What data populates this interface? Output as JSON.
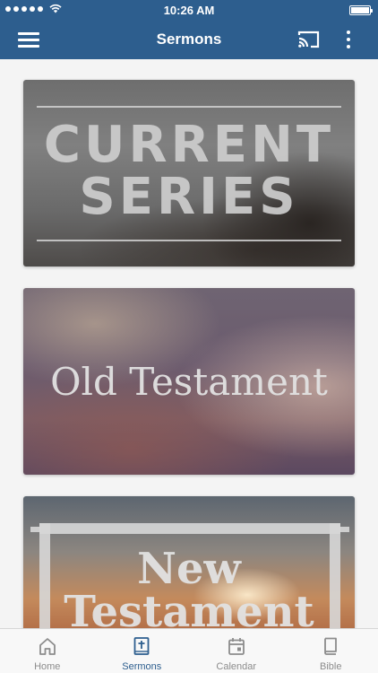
{
  "status_bar": {
    "time": "10:26 AM"
  },
  "nav": {
    "title": "Sermons"
  },
  "cards": [
    {
      "lines": [
        "CURRENT",
        "SERIES"
      ]
    },
    {
      "lines": [
        "Old Testament"
      ]
    },
    {
      "lines": [
        "New",
        "Testament"
      ]
    }
  ],
  "tabs": [
    {
      "label": "Home",
      "icon": "home-icon",
      "active": false
    },
    {
      "label": "Sermons",
      "icon": "bible-cross-icon",
      "active": true
    },
    {
      "label": "Calendar",
      "icon": "calendar-icon",
      "active": false
    },
    {
      "label": "Bible",
      "icon": "book-icon",
      "active": false
    }
  ],
  "colors": {
    "brand": "#2d5e8e",
    "tab_inactive": "#8c8c8c"
  }
}
